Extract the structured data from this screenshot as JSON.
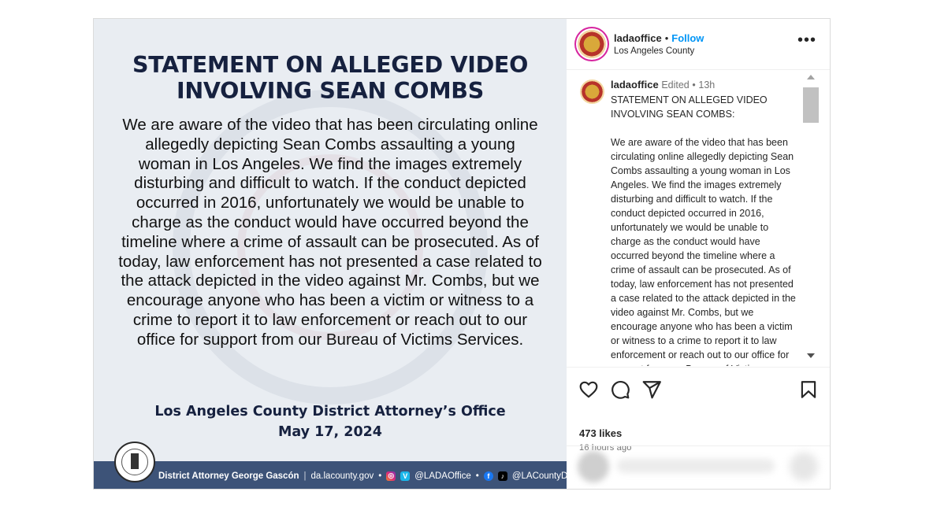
{
  "image": {
    "title_line1": "STATEMENT ON ALLEGED VIDEO",
    "title_line2": "INVOLVING SEAN COMBS",
    "body": "We are aware of the video that has been circulating online allegedly depicting Sean Combs assaulting a young woman in Los Angeles. We find the images extremely disturbing and difficult to watch. If the conduct depicted occurred in 2016, unfortunately we would be unable to charge as the conduct would have occurred beyond the timeline where a crime of assault can be prosecuted. As of today, law enforcement has not presented a case related to the attack depicted in the video against Mr. Combs, but we encourage anyone who has been a victim or witness to a crime to report it to law enforcement or reach out to our office for support from our Bureau of Victims Services.",
    "office": "Los Angeles County District Attorney’s Office",
    "date": "May 17, 2024",
    "footer": {
      "da_name": "District Attorney George Gascón",
      "divider": "|",
      "website": "da.lacounty.gov",
      "bullet": "•",
      "handle1": "@LADAOffice",
      "handle2": "@LACountyDA",
      "ig_glyph": "◎",
      "vimeo_glyph": "V",
      "fb_glyph": "f",
      "tiktok_glyph": "♪"
    }
  },
  "header": {
    "username": "ladaoffice",
    "dot": "•",
    "follow_label": "Follow",
    "location": "Los Angeles County",
    "more_glyph": "•••"
  },
  "caption": {
    "username": "ladaoffice",
    "edited": "Edited",
    "dot": "•",
    "time": "13h",
    "text": "STATEMENT ON ALLEGED VIDEO\nINVOLVING SEAN COMBS:\n\nWe are aware of the video that has been circulating online allegedly depicting Sean Combs assaulting a young woman in Los Angeles. We find the images extremely disturbing and difficult to watch. If the conduct depicted occurred in 2016, unfortunately we would be unable to charge as the conduct would have occurred beyond the timeline where a crime of assault can be prosecuted. As of today, law enforcement has not presented a case related to the attack depicted in the video against Mr. Combs, but we encourage anyone who has been a victim or witness to a crime to report it to law enforcement or reach out to our office for support from our Bureau of Victims Services."
  },
  "actions": {
    "likes": "473 likes",
    "timestamp": "16 hours ago",
    "icons": [
      "heart-icon",
      "comment-icon",
      "share-icon",
      "bookmark-icon"
    ]
  },
  "colors": {
    "follow": "#0095f6",
    "footer_band": "#3d5378",
    "title_navy": "#16213f"
  }
}
